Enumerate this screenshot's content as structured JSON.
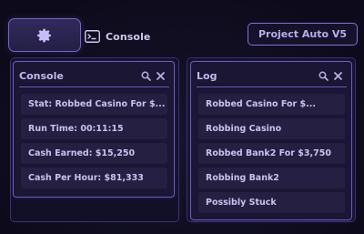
{
  "toolbar": {
    "settings_icon": "gear-icon",
    "console_tab": {
      "icon": "terminal-icon",
      "label": "Console"
    },
    "project_label": "Project Auto V5"
  },
  "console_panel": {
    "title": "Console",
    "icons": [
      "search-icon",
      "close-icon"
    ],
    "rows": [
      "Stat: Robbed Casino For $...",
      "Run Time: 00:11:15",
      "Cash Earned: $15,250",
      "Cash Per Hour: $81,333"
    ]
  },
  "log_panel": {
    "title": "Log",
    "icons": [
      "search-icon",
      "close-icon"
    ],
    "rows": [
      "Robbed Casino For $...",
      "Robbing Casino",
      "Robbed Bank2 For $3,750",
      "Robbing Bank2",
      "Possibly Stuck"
    ]
  },
  "colors": {
    "background": "#0d0b1b",
    "accent": "#7465c9",
    "panel": "#1a1634",
    "row": "#252042",
    "text": "#c9c2ef"
  }
}
